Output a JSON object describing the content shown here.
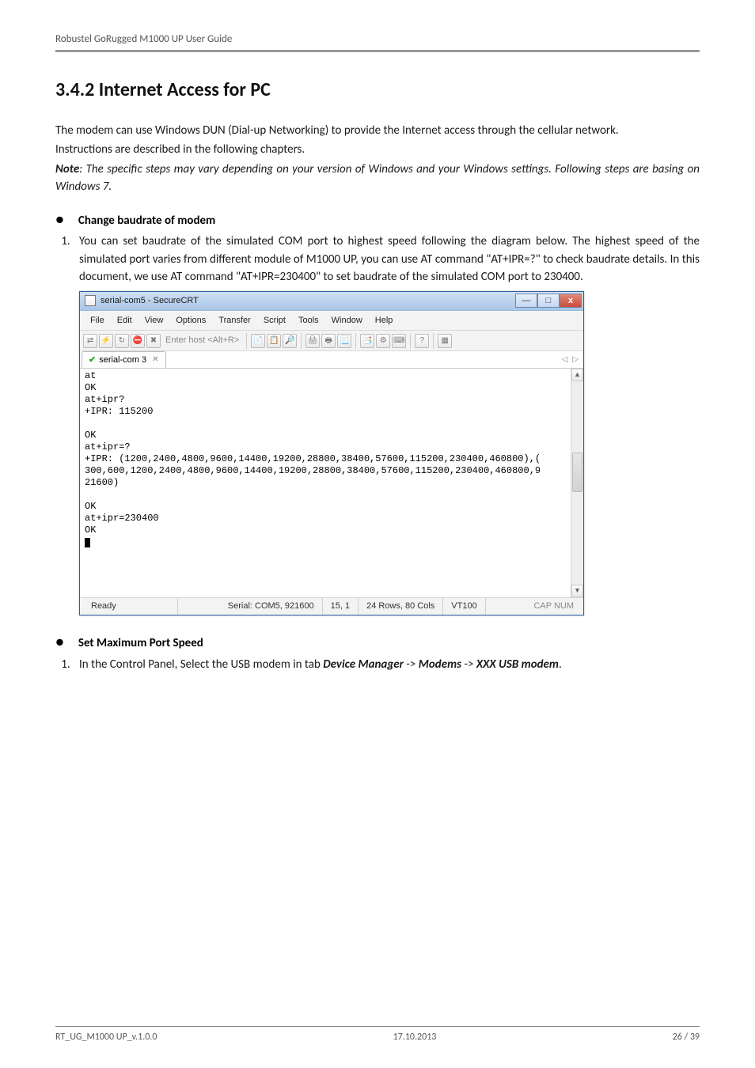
{
  "header": {
    "title": "Robustel GoRugged M1000 UP User Guide"
  },
  "section": {
    "number_title": "3.4.2  Internet Access for PC",
    "para1a": "The modem can use Windows DUN (Dial-up Networking) to provide the Internet access through the cellular network.",
    "para1b": "Instructions are described in the following chapters.",
    "note_prefix": "Note",
    "note_body": ": The specific steps may vary depending on your version of Windows and your Windows settings. Following steps are basing on Windows 7.",
    "bullet1": "Change baudrate of modem",
    "step1_text": "You can set baudrate of the simulated COM port to highest speed following the diagram below. The highest speed of the simulated port varies from different module of M1000 UP, you can use AT command \"AT+IPR=?\" to check baudrate details. In this document, we use AT command \"AT+IPR=230400\" to set baudrate of the simulated COM port to 230400.",
    "bullet2": "Set Maximum Port Speed",
    "step2_prefix": "In the Control Panel, Select the USB modem in tab ",
    "step2_dm": "Device Manager",
    "step2_sep1": " -> ",
    "step2_mod": "Modems",
    "step2_sep2": " -> ",
    "step2_xxx": "XXX USB modem",
    "step2_suffix": "."
  },
  "securecrt": {
    "title": "serial-com5 - SecureCRT",
    "menus": [
      "File",
      "Edit",
      "View",
      "Options",
      "Transfer",
      "Script",
      "Tools",
      "Window",
      "Help"
    ],
    "host_placeholder": "Enter host <Alt+R>",
    "tab_label": "serial-com 3",
    "terminal_lines": [
      "at",
      "OK",
      "at+ipr?",
      "+IPR: 115200",
      "",
      "OK",
      "at+ipr=?",
      "+IPR: (1200,2400,4800,9600,14400,19200,28800,38400,57600,115200,230400,460800),(",
      "300,600,1200,2400,4800,9600,14400,19200,28800,38400,57600,115200,230400,460800,9",
      "21600)",
      "",
      "OK",
      "at+ipr=230400",
      "OK"
    ],
    "status": {
      "ready": "Ready",
      "serial": "Serial: COM5, 921600",
      "pos": "15, 1",
      "size": "24 Rows, 80 Cols",
      "term": "VT100",
      "caps": "CAP  NUM"
    }
  },
  "footer": {
    "left": "RT_UG_M1000 UP_v.1.0.0",
    "center": "17.10.2013",
    "right": "26 / 39"
  }
}
